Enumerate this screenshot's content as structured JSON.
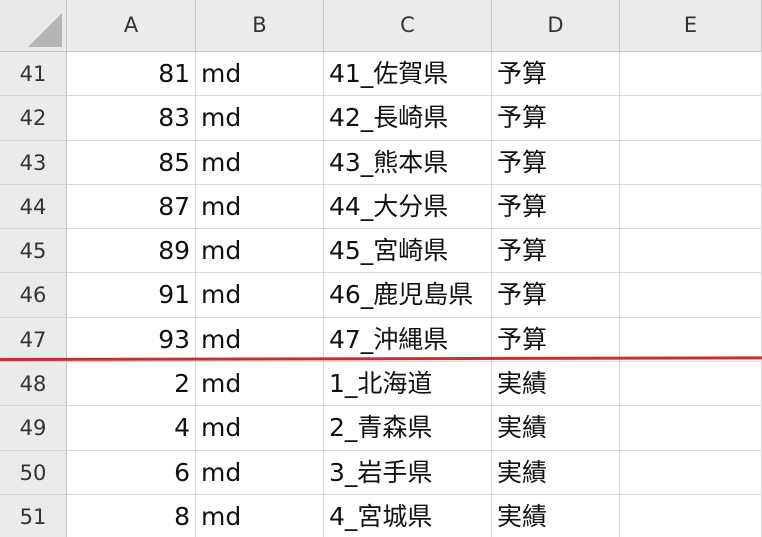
{
  "columns": [
    "A",
    "B",
    "C",
    "D",
    "E"
  ],
  "rows": [
    {
      "num": "41",
      "a": "81",
      "b": "md",
      "c": "41_佐賀県",
      "d": "予算",
      "e": ""
    },
    {
      "num": "42",
      "a": "83",
      "b": "md",
      "c": "42_長崎県",
      "d": "予算",
      "e": ""
    },
    {
      "num": "43",
      "a": "85",
      "b": "md",
      "c": "43_熊本県",
      "d": "予算",
      "e": ""
    },
    {
      "num": "44",
      "a": "87",
      "b": "md",
      "c": "44_大分県",
      "d": "予算",
      "e": ""
    },
    {
      "num": "45",
      "a": "89",
      "b": "md",
      "c": "45_宮崎県",
      "d": "予算",
      "e": ""
    },
    {
      "num": "46",
      "a": "91",
      "b": "md",
      "c": "46_鹿児島県",
      "d": "予算",
      "e": ""
    },
    {
      "num": "47",
      "a": "93",
      "b": "md",
      "c": "47_沖縄県",
      "d": "予算",
      "e": ""
    },
    {
      "num": "48",
      "a": "2",
      "b": "md",
      "c": "1_北海道",
      "d": "実績",
      "e": ""
    },
    {
      "num": "49",
      "a": "4",
      "b": "md",
      "c": "2_青森県",
      "d": "実績",
      "e": ""
    },
    {
      "num": "50",
      "a": "6",
      "b": "md",
      "c": "3_岩手県",
      "d": "実績",
      "e": ""
    },
    {
      "num": "51",
      "a": "8",
      "b": "md",
      "c": "4_宮城県",
      "d": "実績",
      "e": ""
    }
  ],
  "colors": {
    "divider_line": "#d42a2a",
    "header_bg": "#ebebeb",
    "grid_line": "#d9d9d9"
  }
}
